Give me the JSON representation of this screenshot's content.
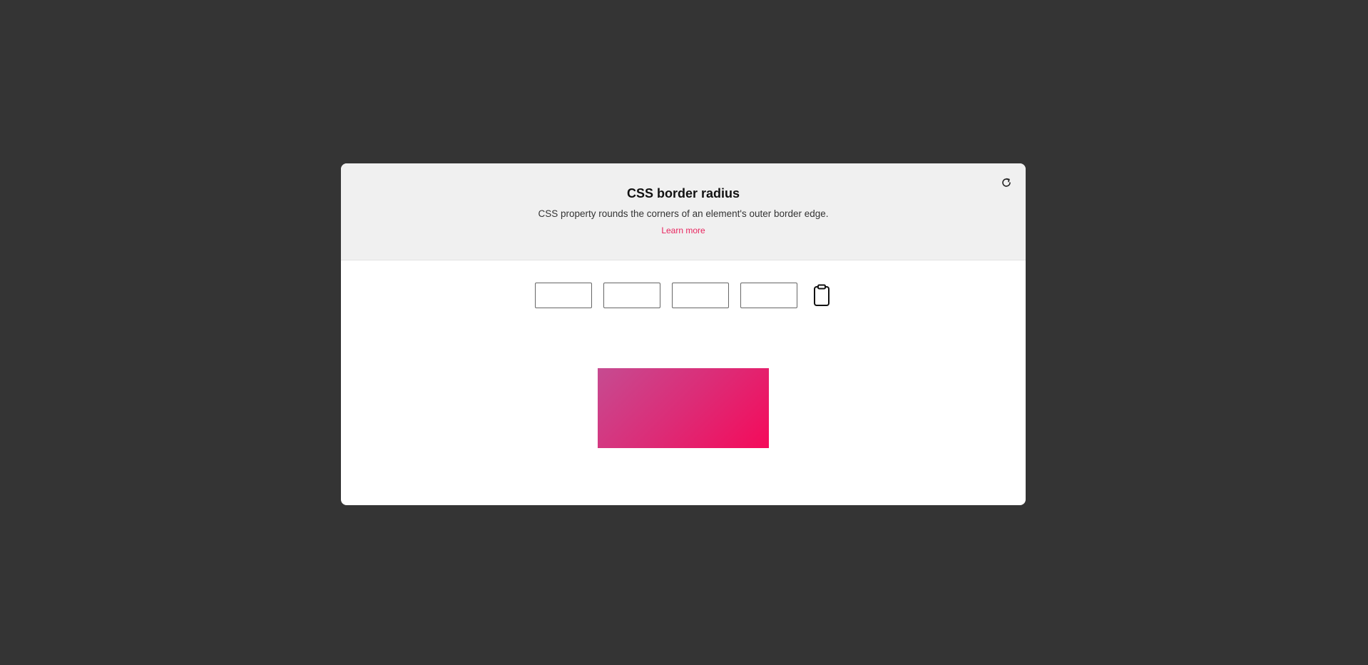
{
  "header": {
    "title": "CSS border radius",
    "description": "CSS property rounds the corners of an element's outer border edge.",
    "learn_more": "Learn more"
  },
  "inputs": {
    "top_left": "",
    "top_right": "",
    "bottom_right": "",
    "bottom_left": ""
  },
  "icons": {
    "reset": "refresh-icon",
    "copy": "clipboard-icon"
  },
  "colors": {
    "background": "#343434",
    "card": "#ffffff",
    "header": "#f0f0f0",
    "link": "#e8245e",
    "gradient_start": "#c64b91",
    "gradient_end": "#f50a5a"
  }
}
